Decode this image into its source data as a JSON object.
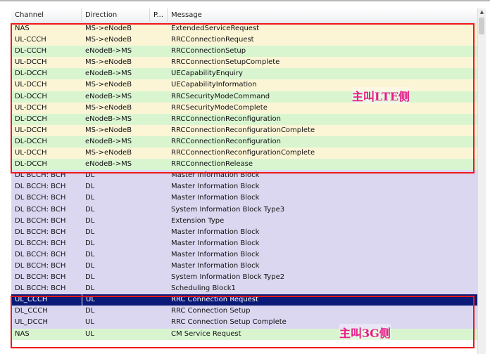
{
  "columns": {
    "channel": "Channel",
    "direction": "Direction",
    "p": "P...",
    "message": "Message"
  },
  "colors": {
    "selected_row": "#0b1a76",
    "highlight_box": "#f0171b",
    "annotation_text": "#e91b8c"
  },
  "rows": [
    {
      "channel": "NAS",
      "direction": "MS->eNodeB",
      "message": "ExtendedServiceRequest",
      "style": "yellow"
    },
    {
      "channel": "UL-CCCH",
      "direction": "MS->eNodeB",
      "message": "RRCConnectionRequest",
      "style": "yellow"
    },
    {
      "channel": "DL-CCCH",
      "direction": "eNodeB->MS",
      "message": "RRCConnectionSetup",
      "style": "green"
    },
    {
      "channel": "UL-DCCH",
      "direction": "MS->eNodeB",
      "message": "RRCConnectionSetupComplete",
      "style": "yellow"
    },
    {
      "channel": "DL-DCCH",
      "direction": "eNodeB->MS",
      "message": "UECapabilityEnquiry",
      "style": "green"
    },
    {
      "channel": "UL-DCCH",
      "direction": "MS->eNodeB",
      "message": "UECapabilityInformation",
      "style": "yellow"
    },
    {
      "channel": "DL-DCCH",
      "direction": "eNodeB->MS",
      "message": "RRCSecurityModeCommand",
      "style": "green"
    },
    {
      "channel": "UL-DCCH",
      "direction": "MS->eNodeB",
      "message": "RRCSecurityModeComplete",
      "style": "yellow"
    },
    {
      "channel": "DL-DCCH",
      "direction": "eNodeB->MS",
      "message": "RRCConnectionReconfiguration",
      "style": "green"
    },
    {
      "channel": "UL-DCCH",
      "direction": "MS->eNodeB",
      "message": "RRCConnectionReconfigurationComplete",
      "style": "yellow"
    },
    {
      "channel": "DL-DCCH",
      "direction": "eNodeB->MS",
      "message": "RRCConnectionReconfiguration",
      "style": "green"
    },
    {
      "channel": "UL-DCCH",
      "direction": "MS->eNodeB",
      "message": "RRCConnectionReconfigurationComplete",
      "style": "yellow"
    },
    {
      "channel": "DL-DCCH",
      "direction": "eNodeB->MS",
      "message": "RRCConnectionRelease",
      "style": "green"
    },
    {
      "channel": "DL BCCH: BCH",
      "direction": "DL",
      "message": "Master Information Block",
      "style": "purple"
    },
    {
      "channel": "DL BCCH: BCH",
      "direction": "DL",
      "message": "Master Information Block",
      "style": "purple"
    },
    {
      "channel": "DL BCCH: BCH",
      "direction": "DL",
      "message": "Master Information Block",
      "style": "purple"
    },
    {
      "channel": "DL BCCH: BCH",
      "direction": "DL",
      "message": "System Information Block Type3",
      "style": "purple"
    },
    {
      "channel": "DL BCCH: BCH",
      "direction": "DL",
      "message": "Extension Type",
      "style": "purple"
    },
    {
      "channel": "DL BCCH: BCH",
      "direction": "DL",
      "message": "Master Information Block",
      "style": "purple"
    },
    {
      "channel": "DL BCCH: BCH",
      "direction": "DL",
      "message": "Master Information Block",
      "style": "purple"
    },
    {
      "channel": "DL BCCH: BCH",
      "direction": "DL",
      "message": "Master Information Block",
      "style": "purple"
    },
    {
      "channel": "DL BCCH: BCH",
      "direction": "DL",
      "message": "Master Information Block",
      "style": "purple"
    },
    {
      "channel": "DL BCCH: BCH",
      "direction": "DL",
      "message": "System Information Block Type2",
      "style": "purple"
    },
    {
      "channel": "DL BCCH: BCH",
      "direction": "DL",
      "message": "Scheduling Block1",
      "style": "purple"
    },
    {
      "channel": "UL_CCCH",
      "direction": "UL",
      "message": "RRC Connection Request",
      "style": "sel"
    },
    {
      "channel": "DL_CCCH",
      "direction": "DL",
      "message": "RRC Connection Setup",
      "style": "purple"
    },
    {
      "channel": "UL_DCCH",
      "direction": "UL",
      "message": "RRC Connection Setup Complete",
      "style": "purple"
    },
    {
      "channel": "NAS",
      "direction": "UL",
      "message": "CM Service Request",
      "style": "green"
    }
  ],
  "annotations": {
    "lte": "主叫LTE侧",
    "g3": "主叫3G侧"
  }
}
